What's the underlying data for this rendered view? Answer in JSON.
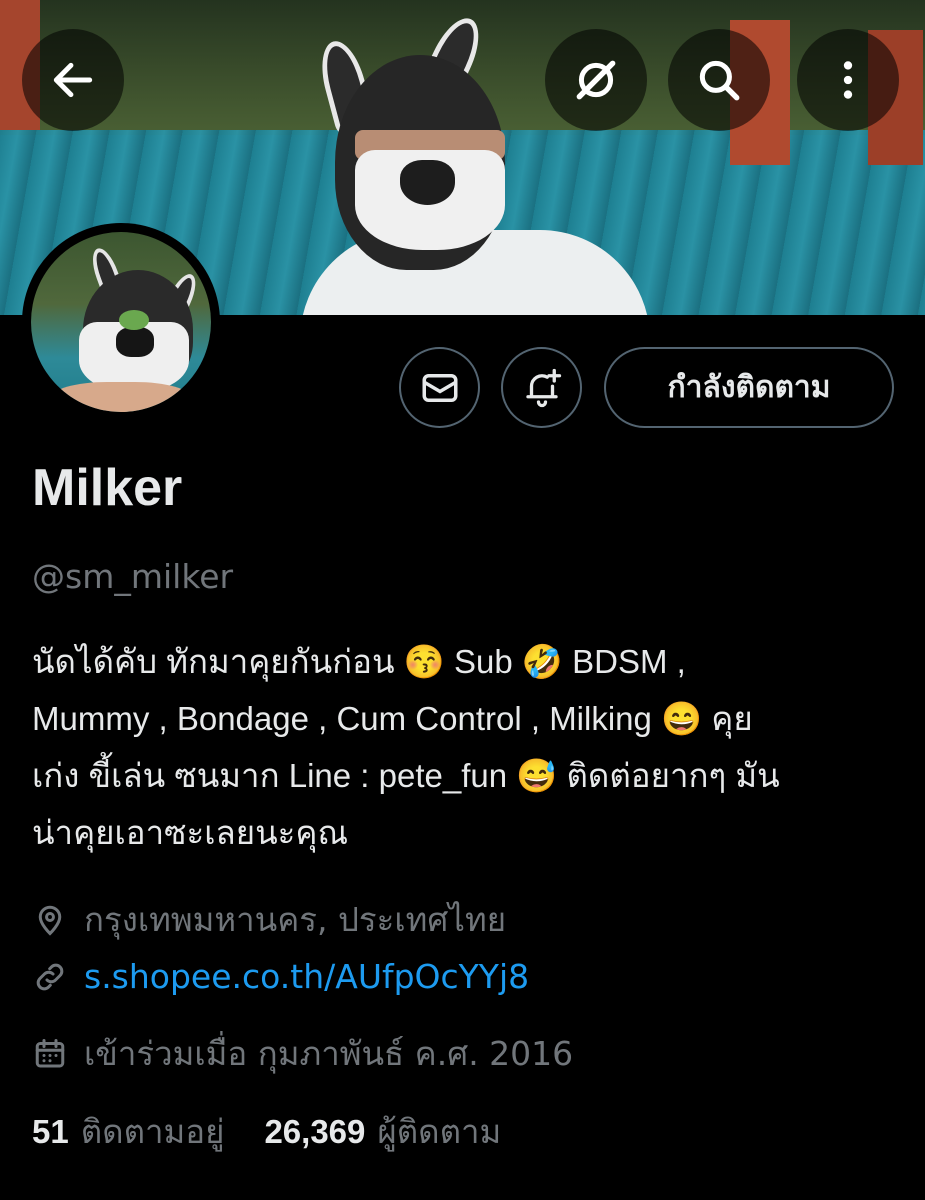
{
  "header": {
    "back_icon": "arrow-left-icon",
    "grok_icon": "grok-icon",
    "search_icon": "search-icon",
    "more_icon": "more-vertical-icon"
  },
  "actions": {
    "message_icon": "mail-icon",
    "notify_icon": "bell-plus-icon",
    "follow_label": "กำลังติดตาม"
  },
  "profile": {
    "name": "Milker",
    "handle": "@sm_milker",
    "bio_lines": [
      "นัดได้คับ ทักมาคุยกันก่อน 😚 Sub 🤣 BDSM ,",
      "Mummy , Bondage , Cum Control , Milking 😄 คุย",
      "เก่ง ขี้เล่น ซนมาก Line : pete_fun 😅 ติดต่อยากๆ มัน",
      "น่าคุยเอาซะเลยนะคุณ"
    ],
    "location": "กรุงเทพมหานคร, ประเทศไทย",
    "link": "s.shopee.co.th/AUfpOcYYj8",
    "joined": "เข้าร่วมเมื่อ กุมภาพันธ์ ค.ศ. 2016"
  },
  "stats": {
    "following_count": "51",
    "following_label": "ติดตามอยู่",
    "followers_count": "26,369",
    "followers_label": "ผู้ติดตาม"
  },
  "colors": {
    "background": "#000000",
    "text": "#e7e9ea",
    "muted": "#71767b",
    "link": "#1d9bf0",
    "border": "#536471"
  }
}
